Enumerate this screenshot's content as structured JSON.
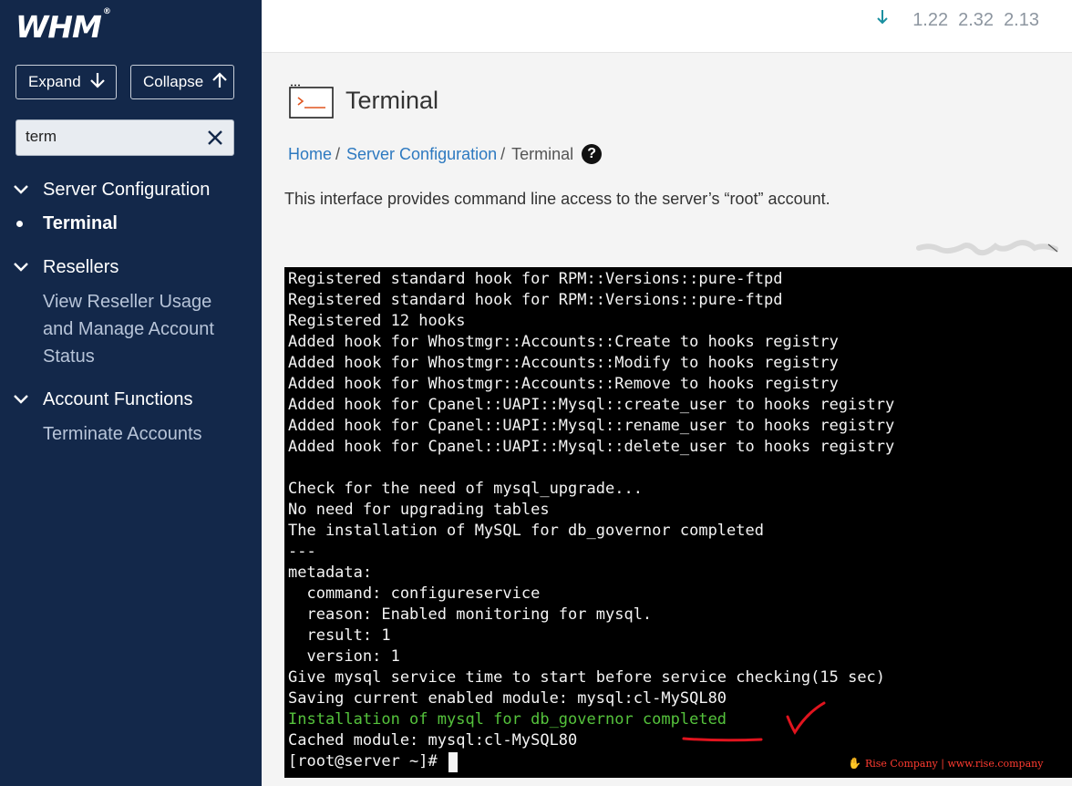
{
  "sidebar": {
    "logo": "WHM",
    "logo_mark": "®",
    "expand_label": "Expand",
    "collapse_label": "Collapse",
    "search_value": "term",
    "groups": [
      {
        "label": "Server Configuration",
        "items": [
          {
            "label": "Terminal",
            "active": true
          }
        ]
      },
      {
        "label": "Resellers",
        "items": [
          {
            "label": "View Reseller Usage and Manage Account Status",
            "lines": [
              "View Reseller Usage",
              "and Manage Account",
              "Status"
            ]
          }
        ]
      },
      {
        "label": "Account Functions",
        "items": [
          {
            "label": "Terminate Accounts"
          }
        ]
      }
    ]
  },
  "header": {
    "load_averages": [
      "1.22",
      "2.32",
      "2.13"
    ],
    "load_icon": "arrow-down-icon"
  },
  "main": {
    "title": "Terminal",
    "title_icon": "terminal-icon",
    "breadcrumb": {
      "home": "Home",
      "section": "Server Configuration",
      "current": "Terminal",
      "separator": "/",
      "help": "?"
    },
    "description": "This interface provides command line access to the server’s “root” account."
  },
  "terminal": {
    "lines": [
      "Registered standard hook for RPM::Versions::pure-ftpd",
      "Registered standard hook for RPM::Versions::pure-ftpd",
      "Registered 12 hooks",
      "Added hook for Whostmgr::Accounts::Create to hooks registry",
      "Added hook for Whostmgr::Accounts::Modify to hooks registry",
      "Added hook for Whostmgr::Accounts::Remove to hooks registry",
      "Added hook for Cpanel::UAPI::Mysql::create_user to hooks registry",
      "Added hook for Cpanel::UAPI::Mysql::rename_user to hooks registry",
      "Added hook for Cpanel::UAPI::Mysql::delete_user to hooks registry",
      "",
      "Check for the need of mysql_upgrade...",
      "No need for upgrading tables",
      "The installation of MySQL for db_governor completed",
      "---",
      "metadata:",
      "  command: configureservice",
      "  reason: Enabled monitoring for mysql.",
      "  result: 1",
      "  version: 1",
      "Give mysql service time to start before service checking(15 sec)",
      "Saving current enabled module: mysql:cl-MySQL80",
      "Installation of mysql for db_governor completed",
      "Cached module: mysql:cl-MySQL80"
    ],
    "highlight_line_index": 21,
    "highlight_color": "#55c33c",
    "prompt": "[root@server ~]# ",
    "annotation_color": "#e0141e"
  },
  "watermark": {
    "text": "Rise Company | www.rise.company"
  }
}
